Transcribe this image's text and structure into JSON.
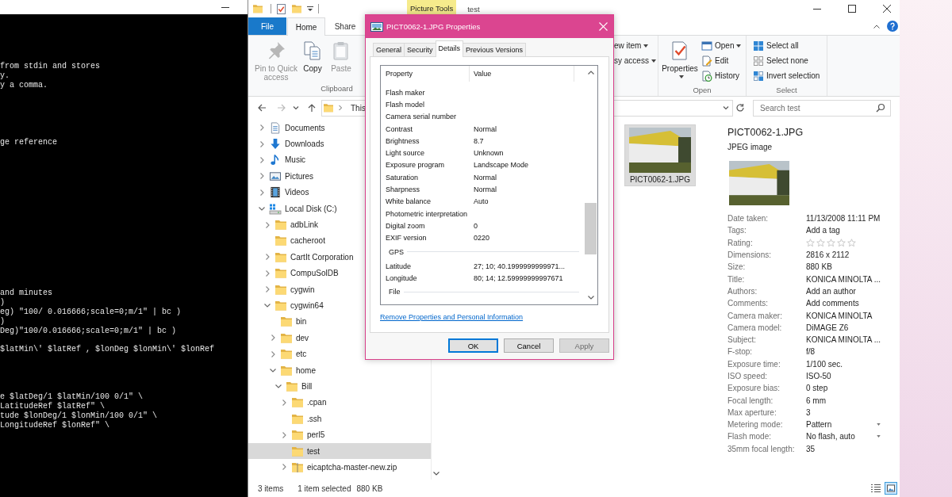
{
  "terminal": {
    "blocks": [
      {
        "lines": [
          "from stdin and stores",
          "y.",
          "y a comma."
        ]
      },
      {
        "lines": [
          "ge reference"
        ]
      },
      {
        "lines": [
          "and minutes",
          ")",
          "eg) \"100/ 0.016666;scale=0;m/1\" | bc )",
          ")",
          "Deg)\"100/0.016666;scale=0;m/1\" | bc )"
        ]
      },
      {
        "lines": [
          "$latMin\\' $latRef , $lonDeg $lonMin\\' $lonRef"
        ]
      },
      {
        "lines": [
          "e $latDeg/1 $latMin/100 0/1\" \\",
          "LatitudeRef $latRef\" \\",
          "tude $lonDeg/1 $lonMin/100 0/1\" \\",
          "LongitudeRef $lonRef\" \\"
        ]
      }
    ]
  },
  "explorer": {
    "context_tab": "Picture Tools",
    "title": "test",
    "ribbon_tabs": [
      {
        "label": "File",
        "kind": "file",
        "selected": false
      },
      {
        "label": "Home",
        "kind": "tab",
        "selected": true
      },
      {
        "label": "Share",
        "kind": "tab",
        "selected": false
      }
    ],
    "ribbon": {
      "clipboard": {
        "label": "Clipboard",
        "buttons": [
          {
            "label": "Pin to Quick access",
            "kind": "pin",
            "disabled": true
          },
          {
            "label": "Copy",
            "kind": "copy",
            "disabled": false
          },
          {
            "label": "Paste",
            "kind": "paste",
            "disabled": true
          }
        ]
      },
      "group_2": {
        "buttons": [
          {
            "label": "ew item",
            "dropdown": true
          },
          {
            "label": "sy access",
            "dropdown": true
          }
        ]
      },
      "open": {
        "label": "Open",
        "properties": {
          "label": "Properties",
          "dropdown": true
        },
        "buttons": [
          {
            "label": "Open",
            "kind": "open",
            "dropdown": true
          },
          {
            "label": "Edit",
            "kind": "edit",
            "dropdown": false
          },
          {
            "label": "History",
            "kind": "history",
            "dropdown": false
          }
        ]
      },
      "select": {
        "label": "Select",
        "buttons": [
          {
            "label": "Select all",
            "kind": "select-all"
          },
          {
            "label": "Select none",
            "kind": "select-none"
          },
          {
            "label": "Invert selection",
            "kind": "invert-selection"
          }
        ]
      }
    },
    "address": {
      "crumb": "This"
    },
    "search": {
      "placeholder": "Search test"
    },
    "navigation_tree": [
      {
        "label": "Documents",
        "kind": "documents",
        "has_children": true,
        "expanded": false,
        "selected": false
      },
      {
        "label": "Downloads",
        "kind": "downloads",
        "has_children": true,
        "expanded": false,
        "selected": false
      },
      {
        "label": "Music",
        "kind": "music",
        "has_children": true,
        "expanded": false,
        "selected": false
      },
      {
        "label": "Pictures",
        "kind": "pictures",
        "has_children": true,
        "expanded": false,
        "selected": false
      },
      {
        "label": "Videos",
        "kind": "videos",
        "has_children": true,
        "expanded": false,
        "selected": false
      },
      {
        "label": "Local Disk (C:)",
        "kind": "drive",
        "expanded": true,
        "selected": false,
        "children": [
          {
            "label": "adbLink",
            "kind": "folder",
            "has_children": true,
            "expanded": false,
            "selected": false
          },
          {
            "label": "cacheroot",
            "kind": "folder",
            "has_children": false,
            "expanded": false,
            "selected": false
          },
          {
            "label": "CartIt Corporation",
            "kind": "folder",
            "has_children": true,
            "expanded": false,
            "selected": false
          },
          {
            "label": "CompuSolDB",
            "kind": "folder",
            "has_children": true,
            "expanded": false,
            "selected": false
          },
          {
            "label": "cygwin",
            "kind": "folder",
            "has_children": true,
            "expanded": false,
            "selected": false
          },
          {
            "label": "cygwin64",
            "kind": "folder",
            "expanded": true,
            "selected": false,
            "children": [
              {
                "label": "bin",
                "kind": "folder",
                "has_children": false,
                "expanded": false,
                "selected": false
              },
              {
                "label": "dev",
                "kind": "folder",
                "has_children": true,
                "expanded": false,
                "selected": false
              },
              {
                "label": "etc",
                "kind": "folder",
                "has_children": true,
                "expanded": false,
                "selected": false
              },
              {
                "label": "home",
                "kind": "folder",
                "expanded": true,
                "selected": false,
                "children": [
                  {
                    "label": "Bill",
                    "kind": "folder",
                    "expanded": true,
                    "selected": false,
                    "children": [
                      {
                        "label": ".cpan",
                        "kind": "folder",
                        "has_children": true,
                        "expanded": false,
                        "selected": false
                      },
                      {
                        "label": ".ssh",
                        "kind": "folder",
                        "has_children": false,
                        "expanded": false,
                        "selected": false
                      },
                      {
                        "label": "perl5",
                        "kind": "folder",
                        "has_children": true,
                        "expanded": false,
                        "selected": false
                      },
                      {
                        "label": "test",
                        "kind": "folder",
                        "has_children": false,
                        "expanded": false,
                        "selected": true
                      },
                      {
                        "label": "eicaptcha-master-new.zip",
                        "kind": "zip",
                        "has_children": true,
                        "expanded": false,
                        "selected": false
                      }
                    ]
                  }
                ]
              }
            ]
          }
        ]
      }
    ],
    "files": [
      {
        "name": "PICT0062-1.JPG",
        "selected": true
      }
    ],
    "details": {
      "name": "PICT0062-1.JPG",
      "type": "JPEG image",
      "properties": [
        {
          "label": "Date taken:",
          "value": "11/13/2008 11:11 PM",
          "kind": "text"
        },
        {
          "label": "Tags:",
          "value": "Add a tag",
          "kind": "text"
        },
        {
          "label": "Rating:",
          "kind": "rating",
          "stars": 0
        },
        {
          "label": "Dimensions:",
          "value": "2816 x 2112",
          "kind": "text"
        },
        {
          "label": "Size:",
          "value": "880 KB",
          "kind": "text"
        },
        {
          "label": "Title:",
          "value": "KONICA MINOLTA ...",
          "kind": "text"
        },
        {
          "label": "Authors:",
          "value": "Add an author",
          "kind": "text"
        },
        {
          "label": "Comments:",
          "value": "Add comments",
          "kind": "text"
        },
        {
          "label": "Camera maker:",
          "value": "KONICA MINOLTA",
          "kind": "text"
        },
        {
          "label": "Camera model:",
          "value": "DiMAGE Z6",
          "kind": "text"
        },
        {
          "label": "Subject:",
          "value": "KONICA MINOLTA ...",
          "kind": "text"
        },
        {
          "label": "F-stop:",
          "value": "f/8",
          "kind": "text"
        },
        {
          "label": "Exposure time:",
          "value": "1/100 sec.",
          "kind": "text"
        },
        {
          "label": "ISO speed:",
          "value": "ISO-50",
          "kind": "text"
        },
        {
          "label": "Exposure bias:",
          "value": "0 step",
          "kind": "text"
        },
        {
          "label": "Focal length:",
          "value": "6 mm",
          "kind": "text"
        },
        {
          "label": "Max aperture:",
          "value": "3",
          "kind": "text"
        },
        {
          "label": "Metering mode:",
          "value": "Pattern",
          "kind": "dropdown"
        },
        {
          "label": "Flash mode:",
          "value": "No flash, auto",
          "kind": "dropdown"
        },
        {
          "label": "35mm focal length:",
          "value": "35",
          "kind": "text"
        }
      ]
    },
    "status_bar": {
      "item_count": "3 items",
      "selection": "1 item selected",
      "size": "880 KB"
    },
    "view_buttons": [
      {
        "kind": "details",
        "selected": false
      },
      {
        "kind": "large-icons",
        "selected": true
      }
    ]
  },
  "dialog": {
    "title": "PICT0062-1.JPG Properties",
    "tabs": [
      {
        "label": "General",
        "selected": false
      },
      {
        "label": "Security",
        "selected": false
      },
      {
        "label": "Details",
        "selected": true
      },
      {
        "label": "Previous Versions",
        "selected": false
      }
    ],
    "columns": [
      "Property",
      "Value"
    ],
    "rows": [
      {
        "kind": "row",
        "property": "Flash maker"
      },
      {
        "kind": "row",
        "property": "Flash model"
      },
      {
        "kind": "row",
        "property": "Camera serial number"
      },
      {
        "kind": "row",
        "property": "Contrast",
        "value": "Normal"
      },
      {
        "kind": "row",
        "property": "Brightness",
        "value": "8.7"
      },
      {
        "kind": "row",
        "property": "Light source",
        "value": "Unknown"
      },
      {
        "kind": "row",
        "property": "Exposure program",
        "value": "Landscape Mode"
      },
      {
        "kind": "row",
        "property": "Saturation",
        "value": "Normal"
      },
      {
        "kind": "row",
        "property": "Sharpness",
        "value": "Normal"
      },
      {
        "kind": "row",
        "property": "White balance",
        "value": "Auto"
      },
      {
        "kind": "row",
        "property": "Photometric interpretation"
      },
      {
        "kind": "row",
        "property": "Digital zoom",
        "value": "0"
      },
      {
        "kind": "row",
        "property": "EXIF version",
        "value": "0220"
      },
      {
        "kind": "group",
        "label": "GPS"
      },
      {
        "kind": "row",
        "property": "Latitude",
        "value": "27; 10; 40.1999999999971..."
      },
      {
        "kind": "row",
        "property": "Longitude",
        "value": "80; 14; 12.59999999997671"
      },
      {
        "kind": "group",
        "label": "File"
      }
    ],
    "link": "Remove Properties and Personal Information",
    "buttons": [
      {
        "label": "OK",
        "default": true,
        "disabled": false
      },
      {
        "label": "Cancel",
        "default": false,
        "disabled": false
      },
      {
        "label": "Apply",
        "default": false,
        "disabled": true
      }
    ]
  }
}
